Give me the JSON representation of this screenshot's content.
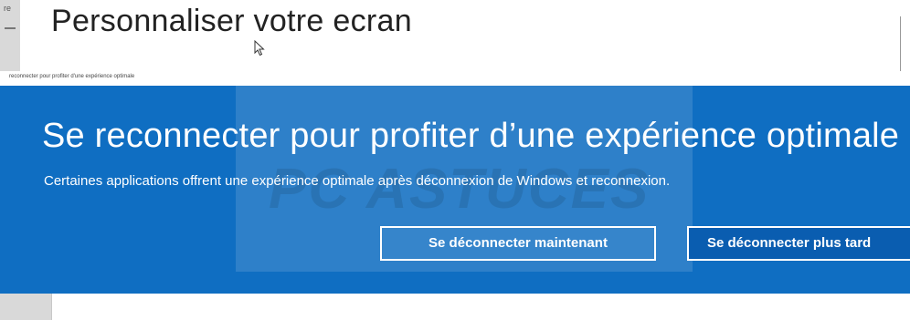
{
  "settings": {
    "title": "Personnaliser votre ecran",
    "side_stub": "re"
  },
  "strip": {
    "tiny_text": "reconnecter pour profiter d'une expérience optimale"
  },
  "banner": {
    "heading": "Se reconnecter pour profiter d’une expérience optimale",
    "subtext": "Certaines applications offrent une expérience optimale après déconnexion de Windows et reconnexion.",
    "watermark": "PC ASTUCES",
    "buttons": {
      "signout_now": "Se déconnecter maintenant",
      "signout_later": "Se déconnecter plus tard"
    }
  },
  "colors": {
    "banner_blue": "#0f6ec2",
    "button_border": "#ffffff"
  },
  "icons": {
    "cursor": "mouse-pointer-icon"
  }
}
